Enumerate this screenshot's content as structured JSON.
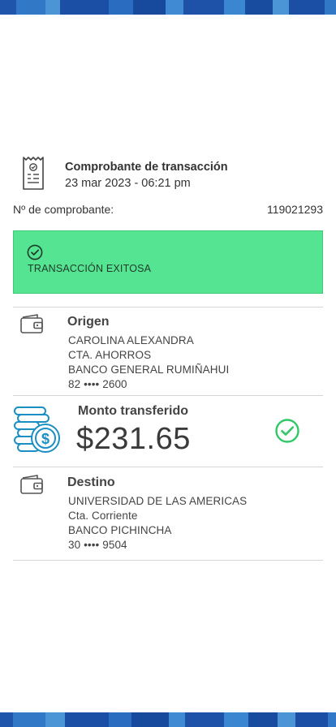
{
  "colors": {
    "success_bg": "#55e491",
    "success_icon": "#2ec866",
    "accent_blue": "#1b8fc4",
    "band_dark": "#1b4fa5",
    "band_light": "#3a86d0"
  },
  "header": {
    "icon": "receipt-document-icon",
    "title": "Comprobante de transacción",
    "date": "23 mar 2023 - 06:21 pm"
  },
  "receipt": {
    "label": "Nº de comprobante:",
    "number": "119021293"
  },
  "status": {
    "icon": "check-circle-icon",
    "message": "TRANSACCIÓN EXITOSA"
  },
  "origin": {
    "icon": "wallet-icon",
    "heading": "Origen",
    "name": "CAROLINA ALEXANDRA",
    "account_type": "CTA. AHORROS",
    "bank": "BANCO GENERAL RUMIÑAHUI",
    "account": "82 •••• 2600"
  },
  "amount": {
    "icon": "coins-dollar-icon",
    "label": "Monto transferido",
    "value": "$231.65",
    "status_icon": "check-circle-icon"
  },
  "destination": {
    "icon": "wallet-icon",
    "heading": "Destino",
    "name": "UNIVERSIDAD DE LAS AMERICAS",
    "account_type": "Cta. Corriente",
    "bank": "BANCO PICHINCHA",
    "account": "30 •••• 9504"
  }
}
